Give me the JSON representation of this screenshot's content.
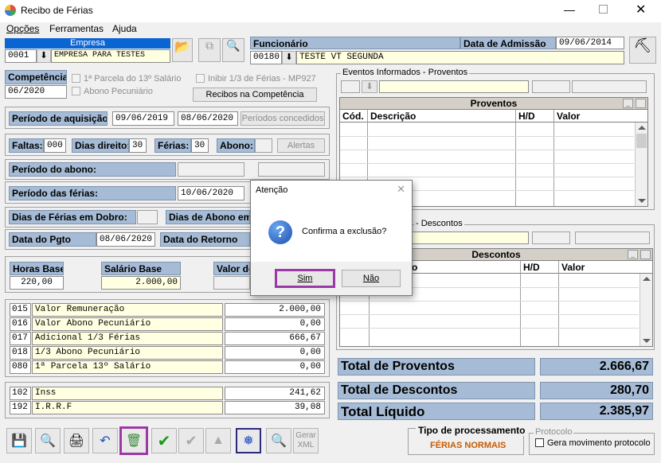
{
  "window": {
    "title": "Recibo de Férias"
  },
  "menu": [
    "Opções",
    "Ferramentas",
    "Ajuda"
  ],
  "empresa": {
    "label": "Empresa",
    "code": "0001",
    "name": "EMPRESA PARA TESTES"
  },
  "funcionario": {
    "label": "Funcionário",
    "code": "00180",
    "name": "TESTE VT SEGUNDA",
    "admissao_label": "Data de Admissão",
    "admissao": "09/06/2014"
  },
  "competencia": {
    "label": "Competência",
    "value": "06/2020"
  },
  "options": {
    "parcela13": "1ª Parcela do 13º Salário",
    "abono": "Abono Pecuniário",
    "inibir": "Inibir 1/3 de Férias - MP927",
    "recibos_btn": "Recibos na Competência"
  },
  "periodo_aquisicao": {
    "label": "Período de aquisição:",
    "inicio": "09/06/2019",
    "fim": "08/06/2020",
    "btn": "Períodos concedidos"
  },
  "faltas": {
    "label": "Faltas:",
    "value": "000"
  },
  "dias_direito": {
    "label": "Dias direito:",
    "value": "30"
  },
  "ferias": {
    "label": "Férias:",
    "value": "30"
  },
  "abono_f": {
    "label": "Abono:"
  },
  "alertas_btn": "Alertas",
  "periodo_abono": {
    "label": "Período do abono:"
  },
  "periodo_ferias": {
    "label": "Período das férias:",
    "inicio": "10/06/2020"
  },
  "dias_dobro": {
    "label": "Dias de Férias em Dobro:"
  },
  "dias_abono_em": {
    "label": "Dias de Abono em"
  },
  "data_pgto": {
    "label": "Data do Pgto",
    "value": "08/06/2020"
  },
  "data_retorno": {
    "label": "Data do Retorno"
  },
  "horas_base": {
    "label": "Horas Base",
    "value": "220,00"
  },
  "salario_base": {
    "label": "Salário Base",
    "value": "2.000,00"
  },
  "valor_de": {
    "label": "Valor de"
  },
  "rubricas": [
    {
      "code": "015",
      "desc": "Valor Remuneração",
      "value": "2.000,00"
    },
    {
      "code": "016",
      "desc": "Valor Abono Pecuniário",
      "value": "0,00"
    },
    {
      "code": "017",
      "desc": "Adicional 1/3 Férias",
      "value": "666,67"
    },
    {
      "code": "018",
      "desc": "1/3 Abono Pecuniário",
      "value": "0,00"
    },
    {
      "code": "080",
      "desc": "1ª Parcela 13º Salário",
      "value": "0,00"
    }
  ],
  "descontos_rub": [
    {
      "code": "102",
      "desc": "Inss",
      "value": "241,62"
    },
    {
      "code": "192",
      "desc": "I.R.R.F",
      "value": "39,08"
    }
  ],
  "eventos_proventos": {
    "title": "Eventos Informados - Proventos"
  },
  "eventos_descontos": {
    "title": "- Descontos"
  },
  "proventos_grid": {
    "title": "Proventos",
    "cols": [
      "Cód.",
      "Descrição",
      "H/D",
      "Valor"
    ]
  },
  "descontos_grid": {
    "title": "Descontos",
    "cols": [
      "o",
      "H/D",
      "Valor"
    ]
  },
  "totals": {
    "proventos_label": "Total de Proventos",
    "proventos": "2.666,67",
    "descontos_label": "Total de Descontos",
    "descontos": "280,70",
    "liquido_label": "Total Líquido",
    "liquido": "2.385,97"
  },
  "tipo_proc": {
    "label": "Tipo de processamento",
    "value": "FÉRIAS NORMAIS"
  },
  "protocolo": {
    "legend": "Protocolo",
    "chk": "Gera movimento protocolo"
  },
  "gerar_xml": "Gerar\nXML",
  "dialog": {
    "title": "Atenção",
    "message": "Confirma a exclusão?",
    "yes": "Sim",
    "no": "Não"
  },
  "colors": {
    "label_bg": "#a6bcd6",
    "yellow": "#ffffe1",
    "orange": "#c85a00",
    "highlight": "#9b3aa6"
  }
}
